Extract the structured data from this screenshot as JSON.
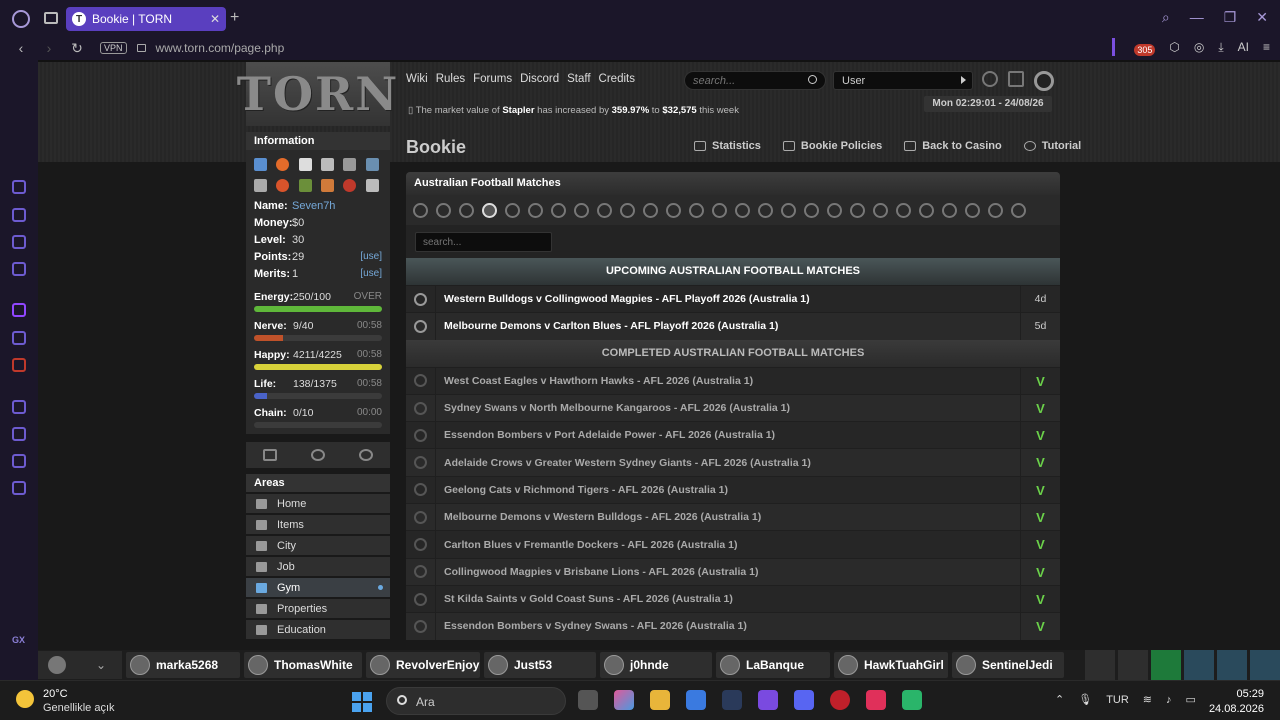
{
  "browser": {
    "tab_title": "Bookie | TORN",
    "tab_favicon": "T",
    "vpn_label": "VPN",
    "url": "www.torn.com/page.php",
    "notif_count": "305",
    "ai_label": "AI"
  },
  "header": {
    "logo": "TORN",
    "nav": [
      "Wiki",
      "Rules",
      "Forums",
      "Discord",
      "Staff",
      "Credits"
    ],
    "search_placeholder": "search...",
    "user_select": "User",
    "ticker_prefix": "The market value of",
    "ticker_item": "Stapler",
    "ticker_mid": "has increased by",
    "ticker_pct": "359.97%",
    "ticker_to": "to",
    "ticker_value": "$32,575",
    "ticker_suffix": "this week",
    "datetime": "Mon 02:29:01 - 24/08/26"
  },
  "sidebar": {
    "info_title": "Information",
    "name_label": "Name:",
    "name_value": "Seven7h",
    "money_label": "Money:",
    "money_value": "$0",
    "level_label": "Level:",
    "level_value": "30",
    "points_label": "Points:",
    "points_value": "29",
    "points_use": "[use]",
    "merits_label": "Merits:",
    "merits_value": "1",
    "merits_use": "[use]",
    "bars": [
      {
        "label": "Energy:",
        "value": "250/100",
        "timer": "OVER",
        "fill": 1.0,
        "color": "#5fb83a"
      },
      {
        "label": "Nerve:",
        "value": "9/40",
        "timer": "00:58",
        "fill": 0.225,
        "color": "#c0522a"
      },
      {
        "label": "Happy:",
        "value": "4211/4225",
        "timer": "00:58",
        "fill": 0.997,
        "color": "#d8d23a"
      },
      {
        "label": "Life:",
        "value": "138/1375",
        "timer": "00:58",
        "fill": 0.1,
        "color": "#4a63c8"
      },
      {
        "label": "Chain:",
        "value": "0/10",
        "timer": "00:00",
        "fill": 0.0,
        "color": "#888888"
      }
    ],
    "areas_title": "Areas",
    "areas": [
      "Home",
      "Items",
      "City",
      "Job",
      "Gym",
      "Properties",
      "Education"
    ]
  },
  "main": {
    "title": "Bookie",
    "links": [
      "Statistics",
      "Bookie Policies",
      "Back to Casino",
      "Tutorial"
    ],
    "panel_title": "Australian Football Matches",
    "search_placeholder": "search...",
    "upcoming_header": "UPCOMING AUSTRALIAN FOOTBALL MATCHES",
    "upcoming": [
      {
        "name": "Western Bulldogs v Collingwood Magpies - AFL Playoff 2026 (Australia 1)",
        "status": "4d"
      },
      {
        "name": "Melbourne Demons v Carlton Blues - AFL Playoff 2026 (Australia 1)",
        "status": "5d"
      }
    ],
    "completed_header": "COMPLETED AUSTRALIAN FOOTBALL MATCHES",
    "completed": [
      {
        "name": "West Coast Eagles v Hawthorn Hawks - AFL 2026 (Australia 1)",
        "status": "V"
      },
      {
        "name": "Sydney Swans v North Melbourne Kangaroos - AFL 2026 (Australia 1)",
        "status": "V"
      },
      {
        "name": "Essendon Bombers v Port Adelaide Power - AFL 2026 (Australia 1)",
        "status": "V"
      },
      {
        "name": "Adelaide Crows v Greater Western Sydney Giants - AFL 2026 (Australia 1)",
        "status": "V"
      },
      {
        "name": "Geelong Cats v Richmond Tigers - AFL 2026 (Australia 1)",
        "status": "V"
      },
      {
        "name": "Melbourne Demons v Western Bulldogs - AFL 2026 (Australia 1)",
        "status": "V"
      },
      {
        "name": "Carlton Blues v Fremantle Dockers - AFL 2026 (Australia 1)",
        "status": "V"
      },
      {
        "name": "Collingwood Magpies v Brisbane Lions - AFL 2026 (Australia 1)",
        "status": "V"
      },
      {
        "name": "St Kilda Saints v Gold Coast Suns - AFL 2026 (Australia 1)",
        "status": "V"
      },
      {
        "name": "Essendon Bombers v Sydney Swans - AFL 2026 (Australia 1)",
        "status": "V"
      }
    ]
  },
  "chat": {
    "users": [
      "marka5268",
      "ThomasWhite",
      "RevolverEnjoy",
      "Just53",
      "j0hnde",
      "LaBanque",
      "HawkTuahGirl",
      "SentinelJedi"
    ]
  },
  "taskbar": {
    "temp": "20°C",
    "weather": "Genellikle açık",
    "search": "Ara",
    "lang": "TUR",
    "time": "05:29",
    "date": "24.08.2026"
  }
}
